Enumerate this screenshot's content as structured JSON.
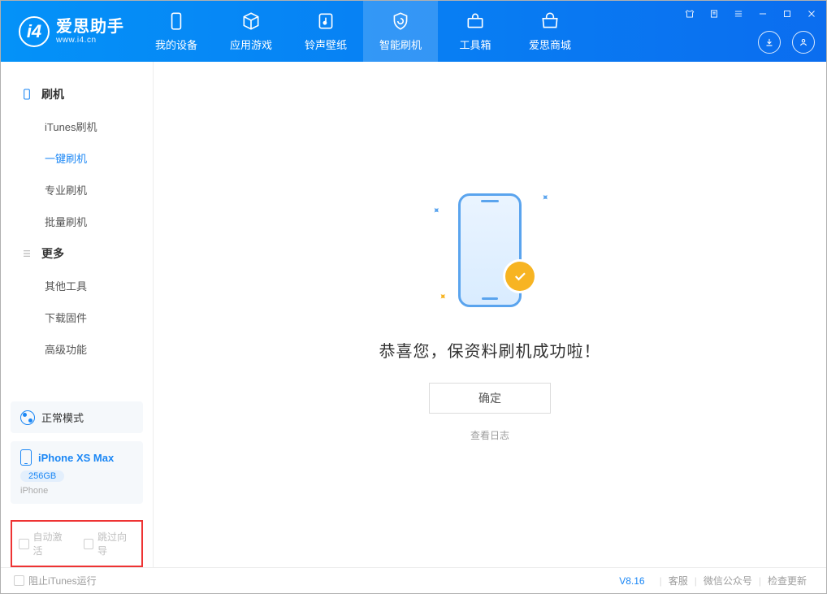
{
  "header": {
    "logo_title": "爱思助手",
    "logo_sub": "www.i4.cn",
    "nav": [
      {
        "label": "我的设备"
      },
      {
        "label": "应用游戏"
      },
      {
        "label": "铃声壁纸"
      },
      {
        "label": "智能刷机"
      },
      {
        "label": "工具箱"
      },
      {
        "label": "爱思商城"
      }
    ]
  },
  "sidebar": {
    "group1_title": "刷机",
    "group1_items": [
      "iTunes刷机",
      "一键刷机",
      "专业刷机",
      "批量刷机"
    ],
    "group2_title": "更多",
    "group2_items": [
      "其他工具",
      "下载固件",
      "高级功能"
    ],
    "mode_label": "正常模式",
    "device_name": "iPhone XS Max",
    "device_capacity": "256GB",
    "device_type": "iPhone",
    "cbx_auto": "自动激活",
    "cbx_skip": "跳过向导"
  },
  "main": {
    "success_text": "恭喜您，保资料刷机成功啦！",
    "ok_button": "确定",
    "view_log": "查看日志"
  },
  "footer": {
    "block_itunes": "阻止iTunes运行",
    "version": "V8.16",
    "link_service": "客服",
    "link_wechat": "微信公众号",
    "link_update": "检查更新"
  }
}
